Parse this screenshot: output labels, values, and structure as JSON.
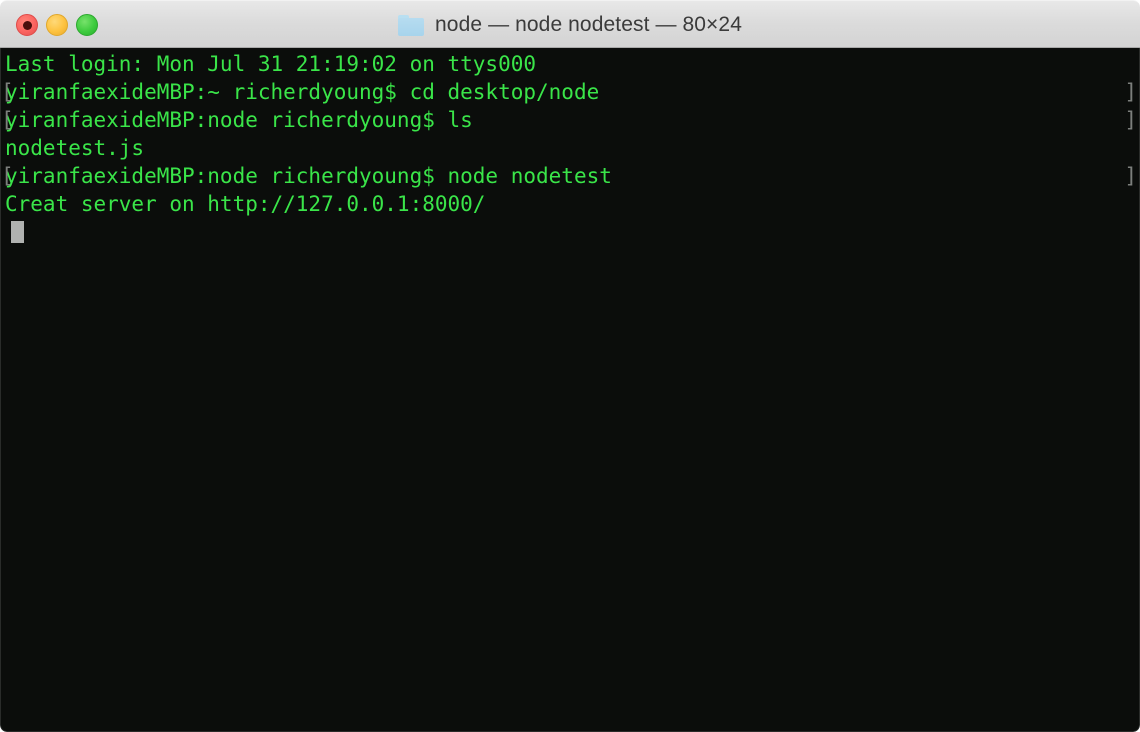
{
  "window": {
    "title": "node — node nodetest — 80×24",
    "folder_icon": "folder-icon",
    "controls": {
      "close_label": "close",
      "minimize_label": "minimize",
      "zoom_label": "zoom"
    },
    "columns": 80,
    "rows": 24,
    "colors": {
      "terminal_background": "#0b0d0b",
      "terminal_foreground": "#3ae549",
      "prompt_mark": "#7c7f7c",
      "cursor": "#b0b2b0",
      "titlebar_background": "#dcdcdc",
      "title_text": "#3b3b3b",
      "close_button": "#fb6460",
      "minimize_button": "#fdc23f",
      "zoom_button": "#3ecb3e"
    }
  },
  "terminal": {
    "lines": [
      {
        "mark_left": "",
        "text": "Last login: Mon Jul 31 21:19:02 on ttys000",
        "mark_right": ""
      },
      {
        "mark_left": "[",
        "text": "yiranfaexideMBP:~ richerdyoung$ cd desktop/node",
        "mark_right": "]"
      },
      {
        "mark_left": "[",
        "text": "yiranfaexideMBP:node richerdyoung$ ls",
        "mark_right": "]"
      },
      {
        "mark_left": "",
        "text": "nodetest.js",
        "mark_right": ""
      },
      {
        "mark_left": "[",
        "text": "yiranfaexideMBP:node richerdyoung$ node nodetest",
        "mark_right": "]"
      },
      {
        "mark_left": "",
        "text": "Creat server on http://127.0.0.1:8000/",
        "mark_right": ""
      }
    ],
    "cursor_line_index": 6
  }
}
